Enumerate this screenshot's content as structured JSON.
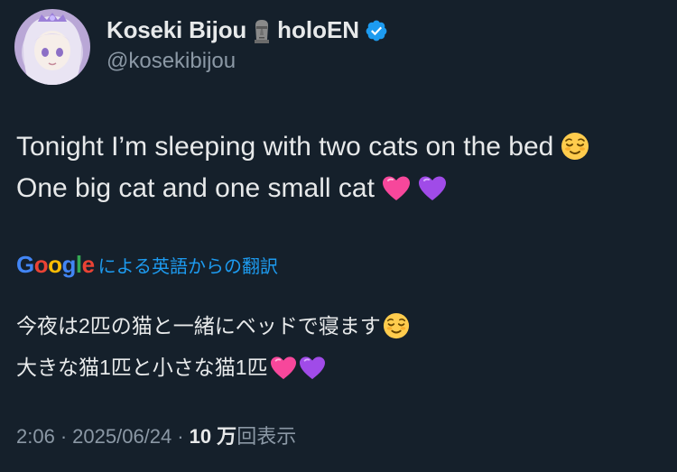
{
  "author": {
    "display_name": "Koseki Bijou",
    "name_emoji": "moai-icon",
    "org": "holoEN",
    "verified_icon": "verified-badge-icon",
    "verified_color": "#1d9bf0",
    "handle": "@kosekibijou"
  },
  "tweet": {
    "line1": "Tonight I’m sleeping with two cats on the bed",
    "line1_emoji": "relieved-face-emoji",
    "line2": "One big cat and one small cat",
    "line2_emojis": [
      "pink-heart-emoji",
      "purple-heart-emoji"
    ]
  },
  "translation": {
    "provider": "Google",
    "label": "による英語からの翻訳",
    "line1": "今夜は2匹の猫と一緒にベッドで寝ます",
    "line2": "大きな猫1匹と小さな猫1匹"
  },
  "meta": {
    "time": "2:06",
    "separator": "·",
    "date": "2025/06/24",
    "views_count": "10 万",
    "views_label": "回表示"
  },
  "colors": {
    "background": "#15202b",
    "text": "#e7e9ea",
    "secondary": "#8b98a5",
    "link": "#1d9bf0"
  }
}
